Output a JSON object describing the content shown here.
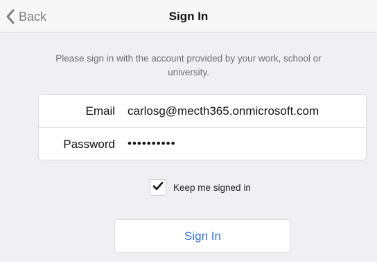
{
  "nav": {
    "back_label": "Back",
    "title": "Sign In"
  },
  "instructions": "Please sign in with the account provided by your work, school or university.",
  "form": {
    "email_label": "Email",
    "email_value": "carlosg@mecth365.onmicrosoft.com",
    "password_label": "Password",
    "password_value": "••••••••••"
  },
  "keep_signed_in": {
    "label": "Keep me signed in",
    "checked": true
  },
  "signin_button": "Sign In",
  "colors": {
    "accent": "#2f6fd6",
    "background": "#efeff4"
  },
  "icons": {
    "back": "chevron-left-icon",
    "check": "checkmark-icon"
  }
}
